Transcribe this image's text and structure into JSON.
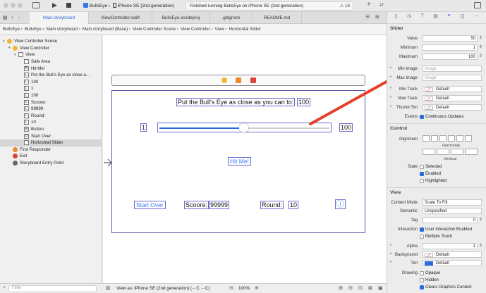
{
  "toolbar": {
    "scheme": "BullsEye",
    "device": "iPhone SE (2nd generation)",
    "status": "Finished running BullsEye on iPhone SE (2nd generation)",
    "warning_count": "18"
  },
  "tabs": [
    {
      "label": "Main.storyboard",
      "active": true
    },
    {
      "label": "ViewController.swift"
    },
    {
      "label": "BullsEye.xcodeproj"
    },
    {
      "label": ".gitignore"
    },
    {
      "label": "README.md"
    }
  ],
  "breadcrumb": [
    "BullsEye",
    "BullsEye",
    "Main.storyboard",
    "Main.storyboard (Base)",
    "View Controller Scene",
    "View Controller",
    "View",
    "Horizontal Slider"
  ],
  "navigator": {
    "rows": [
      {
        "label": "View Controller Scene",
        "icon": "",
        "level": 0
      },
      {
        "label": "View Controller",
        "icon": "",
        "level": 1
      },
      {
        "label": "View",
        "icon": "",
        "level": 2
      },
      {
        "label": "Safe Area",
        "icon": "",
        "level": 3
      },
      {
        "label": "Hit Me!",
        "icon": "B",
        "level": 3
      },
      {
        "label": "Put the Bull's Eye as close a...",
        "icon": "L",
        "level": 3
      },
      {
        "label": "100",
        "icon": "L",
        "level": 3
      },
      {
        "label": "1",
        "icon": "L",
        "level": 3
      },
      {
        "label": "100",
        "icon": "L",
        "level": 3
      },
      {
        "label": "Scoore:",
        "icon": "L",
        "level": 3
      },
      {
        "label": "99999",
        "icon": "L",
        "level": 3
      },
      {
        "label": "Round:",
        "icon": "L",
        "level": 3
      },
      {
        "label": "10",
        "icon": "L",
        "level": 3
      },
      {
        "label": "Button",
        "icon": "B",
        "level": 3
      },
      {
        "label": "Start Over",
        "icon": "B",
        "level": 3
      },
      {
        "label": "Horizontal Slider",
        "icon": "",
        "level": 3,
        "selected": true
      },
      {
        "label": "First Responder",
        "icon": "",
        "level": 1
      },
      {
        "label": "Exit",
        "icon": "",
        "level": 1
      },
      {
        "label": "Storyboard Entry Point",
        "icon": "",
        "level": 1
      }
    ],
    "filter_placeholder": "Filter"
  },
  "scene": {
    "instruction": "Put the Bull's Eye as close as you can to:",
    "target_value": "100",
    "slider_min": "1",
    "slider_max": "100",
    "slider_value": 50,
    "hit_me": "Hit Me!",
    "start_over": "Start Over",
    "score_label": "Scoore:",
    "score_value": "99999",
    "round_label": "Round:",
    "round_value": "10",
    "info_glyph": "ⓘ"
  },
  "bottombar": {
    "view_as": "View as: iPhone SE (2nd generation) (←C ←C)",
    "zoom": "100%"
  },
  "inspector": {
    "slider_title": "Slider",
    "value_label": "Value",
    "value": "50",
    "minimum_label": "Minimum",
    "minimum": "1",
    "maximum_label": "Maximum",
    "maximum": "100",
    "min_image_label": "Min Image",
    "min_image_placeholder": "Image",
    "max_image_label": "Max Image",
    "max_image_placeholder": "Image",
    "min_track_label": "Min Track",
    "min_track": "Default",
    "max_track_label": "Max Track",
    "max_track": "Default",
    "thumb_tint_label": "Thumb Tint",
    "thumb_tint": "Default",
    "events_label": "Events",
    "continuous_updates": "Continuous Updates",
    "control_title": "Control",
    "alignment_label": "Alignment",
    "horizontal_label": "Horizontal",
    "vertical_label": "Vertical",
    "state_label": "State",
    "selected": "Selected",
    "enabled": "Enabled",
    "highlighted": "Highlighted",
    "view_title": "View",
    "content_mode_label": "Content Mode",
    "content_mode": "Scale To Fill",
    "semantic_label": "Semantic",
    "semantic": "Unspecified",
    "tag_label": "Tag",
    "tag": "0",
    "interaction_label": "Interaction",
    "user_interaction": "User Interaction Enabled",
    "multiple_touch": "Multiple Touch",
    "alpha_label": "Alpha",
    "alpha": "1",
    "background_label": "Background",
    "background": "Default",
    "tint_label": "Tint",
    "tint": "Default",
    "drawing_label": "Drawing",
    "opaque": "Opaque",
    "hidden": "Hidden",
    "clears_graphics": "Clears Graphics Context"
  },
  "colors": {
    "accent": "#2a6ad8",
    "arrow": "#e4402a",
    "scene_border": "#5b57a6",
    "button_text": "#3478f6"
  }
}
